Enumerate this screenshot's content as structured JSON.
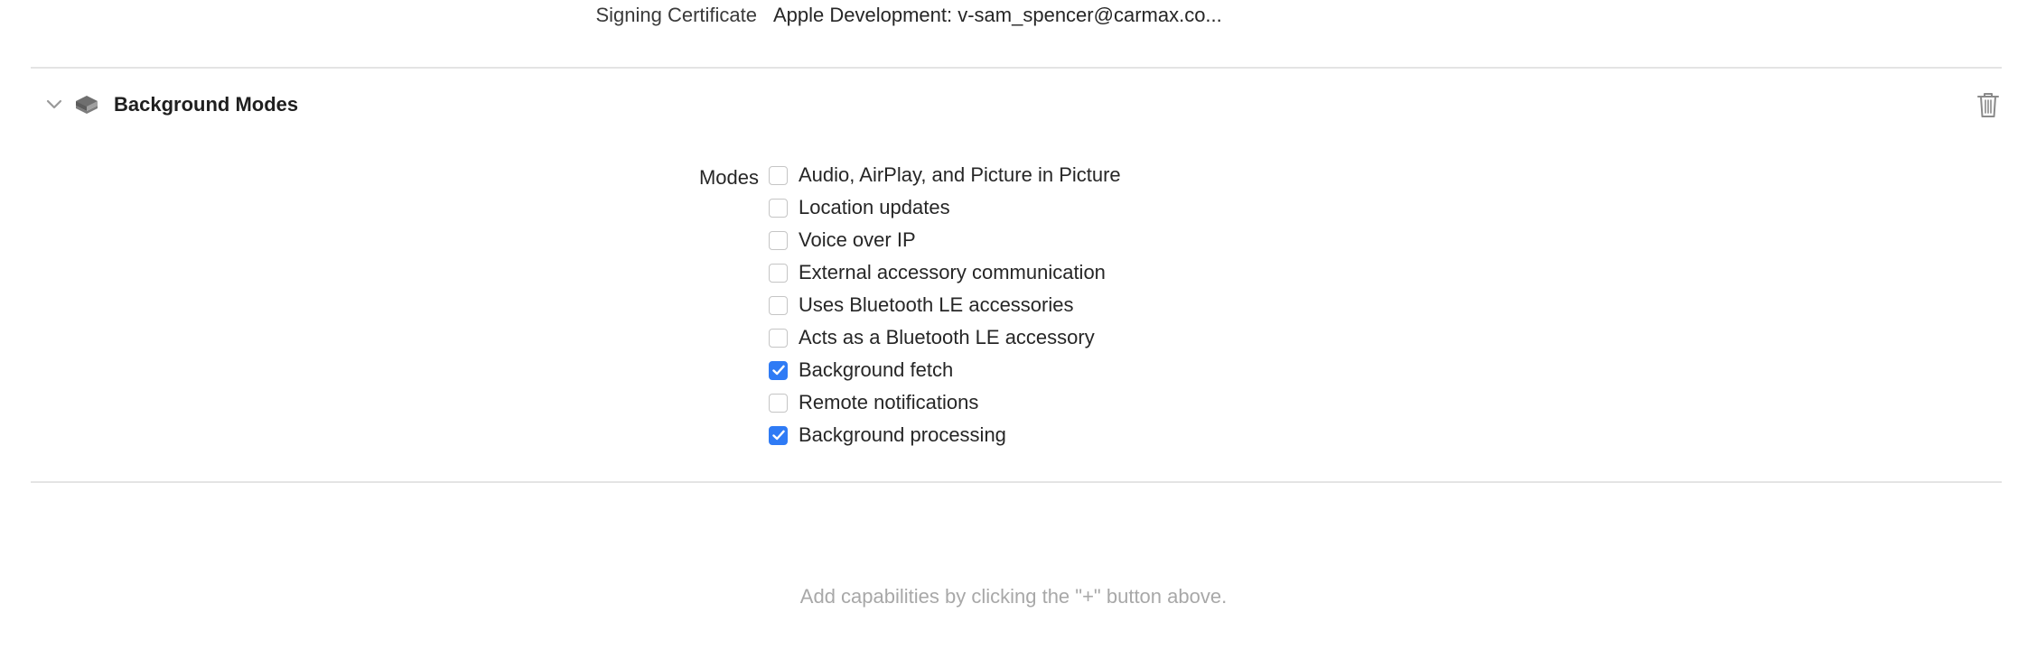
{
  "signing": {
    "label": "Signing Certificate",
    "value": "Apple Development: v-sam_spencer@carmax.co..."
  },
  "section": {
    "title": "Background Modes",
    "icon": "layers-icon",
    "collapse_icon": "chevron-down-icon",
    "delete_icon": "trash-icon"
  },
  "modes": {
    "label": "Modes",
    "items": [
      {
        "label": "Audio, AirPlay, and Picture in Picture",
        "checked": false
      },
      {
        "label": "Location updates",
        "checked": false
      },
      {
        "label": "Voice over IP",
        "checked": false
      },
      {
        "label": "External accessory communication",
        "checked": false
      },
      {
        "label": "Uses Bluetooth LE accessories",
        "checked": false
      },
      {
        "label": "Acts as a Bluetooth LE accessory",
        "checked": false
      },
      {
        "label": "Background fetch",
        "checked": true
      },
      {
        "label": "Remote notifications",
        "checked": false
      },
      {
        "label": "Background processing",
        "checked": true
      }
    ]
  },
  "hint": "Add capabilities by clicking the \"+\" button above.",
  "colors": {
    "accent": "#2f7bf5",
    "divider": "#e4e4e4",
    "hint_text": "#a8a8a8"
  }
}
